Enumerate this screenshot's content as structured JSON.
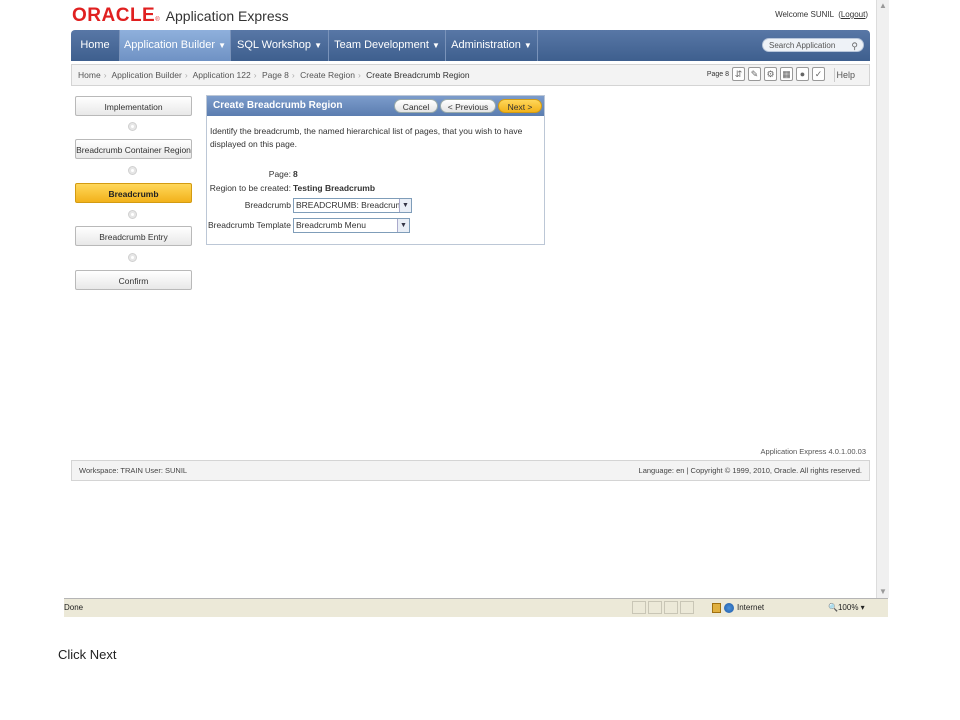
{
  "header": {
    "logo_oracle": "ORACLE",
    "logo_reg": "®",
    "logo_product": "Application Express",
    "welcome_text": "Welcome SUNIL",
    "logout_label": "Logout"
  },
  "nav": {
    "tabs": [
      {
        "label": "Home",
        "active": false
      },
      {
        "label": "Application Builder",
        "active": true,
        "caret": "▼"
      },
      {
        "label": "SQL Workshop",
        "active": false,
        "caret": "▼"
      },
      {
        "label": "Team Development",
        "active": false,
        "caret": "▼"
      },
      {
        "label": "Administration",
        "active": false,
        "caret": "▼"
      }
    ],
    "search_placeholder": "Search Application"
  },
  "breadcrumb": {
    "items": [
      "Home",
      "Application Builder",
      "Application 122",
      "Page 8",
      "Create Region",
      "Create Breadcrumb Region"
    ],
    "page_label": "Page 8",
    "help_label": "Help"
  },
  "wizard": {
    "steps": [
      {
        "label": "Implementation",
        "active": false
      },
      {
        "label": "Breadcrumb Container Region",
        "active": false
      },
      {
        "label": "Breadcrumb",
        "active": true
      },
      {
        "label": "Breadcrumb Entry",
        "active": false
      },
      {
        "label": "Confirm",
        "active": false
      }
    ]
  },
  "region": {
    "title": "Create Breadcrumb Region",
    "cancel_label": "Cancel",
    "previous_label": "< Previous",
    "next_label": "Next >",
    "description": "Identify the breadcrumb, the named hierarchical list of pages, that you wish to have displayed on this page.",
    "fields": {
      "page_label": "Page:",
      "page_value": "8",
      "region_label": "Region to be created:",
      "region_value": "Testing Breadcrumb",
      "breadcrumb_label": "Breadcrumb",
      "breadcrumb_value": "BREADCRUMB: Breadcrumb",
      "template_label": "Breadcrumb Template",
      "template_value": "Breadcrumb Menu"
    }
  },
  "footer": {
    "version": "Application Express 4.0.1.00.03",
    "workspace": "Workspace: TRAIN User: SUNIL",
    "copyright": "Language: en | Copyright © 1999, 2010, Oracle. All rights reserved."
  },
  "statusbar": {
    "status": "Done",
    "zone": "Internet",
    "zoom": "100%"
  },
  "caption": "Click Next",
  "colors": {
    "nav_bg": "#4a6a9a",
    "nav_active": "#7f9fcf",
    "accent_button": "#f5b82a",
    "oracle_red": "#e02020"
  }
}
